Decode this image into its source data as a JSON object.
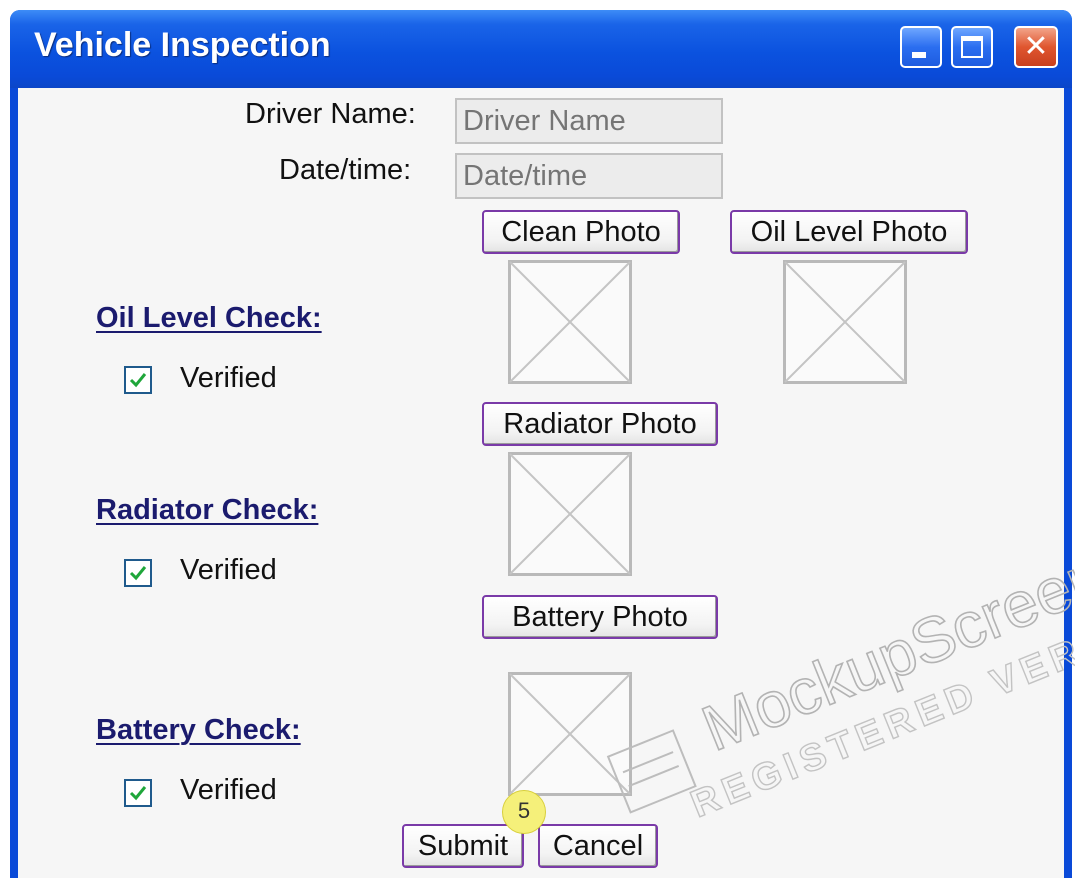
{
  "window": {
    "title": "Vehicle Inspection",
    "accent_color": "#0a4ad8"
  },
  "form": {
    "driver_name_label": "Driver Name:",
    "driver_name_placeholder": "Driver Name",
    "datetime_label": "Date/time:",
    "datetime_placeholder": "Date/time"
  },
  "buttons": {
    "clean_photo": "Clean Photo",
    "oil_level_photo": "Oil Level Photo",
    "radiator_photo": "Radiator Photo",
    "battery_photo": "Battery Photo",
    "submit": "Submit",
    "cancel": "Cancel"
  },
  "sections": [
    {
      "title": "Oil Level Check:",
      "checkbox_label": "Verified",
      "checked": true
    },
    {
      "title": "Radiator Check:",
      "checkbox_label": "Verified",
      "checked": true
    },
    {
      "title": "Battery Check:",
      "checkbox_label": "Verified",
      "checked": true
    }
  ],
  "annotation_badge": "5",
  "watermark": {
    "brand": "MockupScreens",
    "note": "REGISTERED VERSION"
  },
  "icons": [
    "minimize-icon",
    "maximize-icon",
    "close-icon",
    "image-placeholder-icon",
    "checkmark-icon"
  ]
}
